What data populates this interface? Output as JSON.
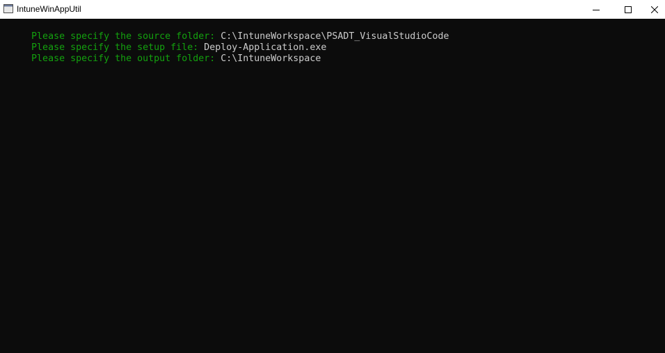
{
  "window": {
    "title": "IntuneWinAppUtil",
    "icon": "console-app-icon",
    "controls": {
      "minimize": "minimize-icon",
      "maximize": "maximize-icon",
      "close": "close-icon"
    }
  },
  "console": {
    "colors": {
      "background": "#0c0c0c",
      "prompt": "#13a10e",
      "answer": "#cccccc"
    },
    "lines": [
      {
        "prompt": "Please specify the source folder: ",
        "answer": "C:\\IntuneWorkspace\\PSADT_VisualStudioCode"
      },
      {
        "prompt": "Please specify the setup file: ",
        "answer": "Deploy-Application.exe"
      },
      {
        "prompt": "Please specify the output folder: ",
        "answer": "C:\\IntuneWorkspace"
      }
    ]
  }
}
